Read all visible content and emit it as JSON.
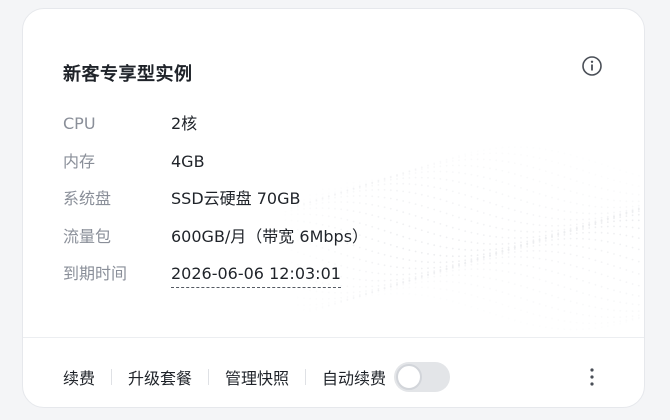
{
  "card": {
    "title": "新客专享型实例"
  },
  "specs": [
    {
      "label": "CPU",
      "value": "2核"
    },
    {
      "label": "内存",
      "value": "4GB"
    },
    {
      "label": "系统盘",
      "value": "SSD云硬盘 70GB"
    },
    {
      "label": "流量包",
      "value": "600GB/月（带宽 6Mbps）"
    },
    {
      "label": "到期时间",
      "value": "2026-06-06 12:03:01"
    }
  ],
  "footer": {
    "renew": "续费",
    "upgrade": "升级套餐",
    "snapshots": "管理快照",
    "auto_renew": "自动续费",
    "auto_renew_enabled": false
  },
  "icons": {
    "info": "info-icon",
    "more": "more-vertical-icon"
  },
  "colors": {
    "title_text": "#1f2329",
    "label_text": "#8a8f99",
    "toggle_off": "#e3e5e8"
  }
}
